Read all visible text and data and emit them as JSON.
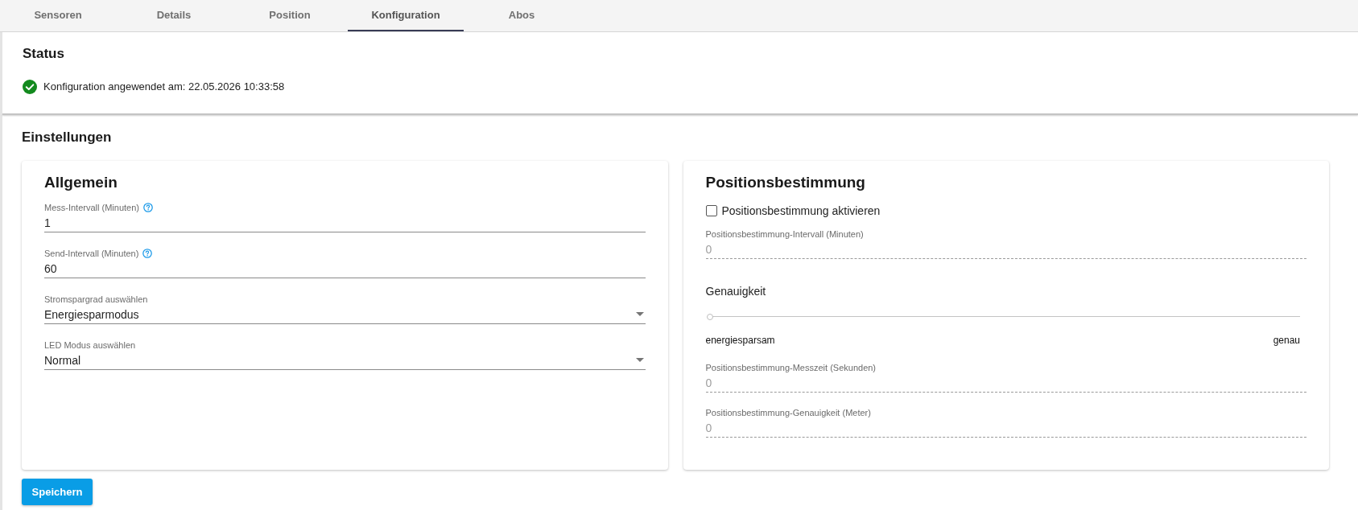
{
  "tabs": [
    {
      "label": "Sensoren",
      "selected": false
    },
    {
      "label": "Details",
      "selected": false
    },
    {
      "label": "Position",
      "selected": false
    },
    {
      "label": "Konfiguration",
      "selected": true
    },
    {
      "label": "Abos",
      "selected": false
    }
  ],
  "status": {
    "title": "Status",
    "kind": "success",
    "message": "Konfiguration angewendet am: 22.05.2026 10:33:58"
  },
  "settings": {
    "title": "Einstellungen",
    "general": {
      "title": "Allgemein",
      "fields": [
        {
          "kind": "text",
          "label": "Mess-Intervall (Minuten)",
          "value": "1",
          "help": true,
          "disabled": false
        },
        {
          "kind": "text",
          "label": "Send-Intervall (Minuten)",
          "value": "60",
          "help": true,
          "disabled": false
        },
        {
          "kind": "select",
          "label": "Stromspargrad auswählen",
          "value": "Energiesparmodus",
          "help": false,
          "disabled": false
        },
        {
          "kind": "select",
          "label": "LED Modus auswählen",
          "value": "Normal",
          "help": false,
          "disabled": false
        }
      ]
    },
    "positioning": {
      "title": "Positionsbestimmung",
      "items": [
        {
          "kind": "checkbox",
          "label": "Positionsbestimmung aktivieren",
          "checked": false
        },
        {
          "kind": "text",
          "label": "Positionsbestimmung-Intervall (Minuten)",
          "value": "0",
          "help": false,
          "disabled": true
        },
        {
          "kind": "slider",
          "label": "Genauigkeit",
          "level": 0,
          "min_label": "energiesparsam",
          "max_label": "genau",
          "disabled": true
        },
        {
          "kind": "text",
          "label": "Positionsbestimmung-Messzeit (Sekunden)",
          "value": "0",
          "help": false,
          "disabled": true
        },
        {
          "kind": "text",
          "label": "Positionsbestimmung-Genauigkeit (Meter)",
          "value": "0",
          "help": false,
          "disabled": true
        }
      ]
    }
  },
  "save_button": "Speichern"
}
